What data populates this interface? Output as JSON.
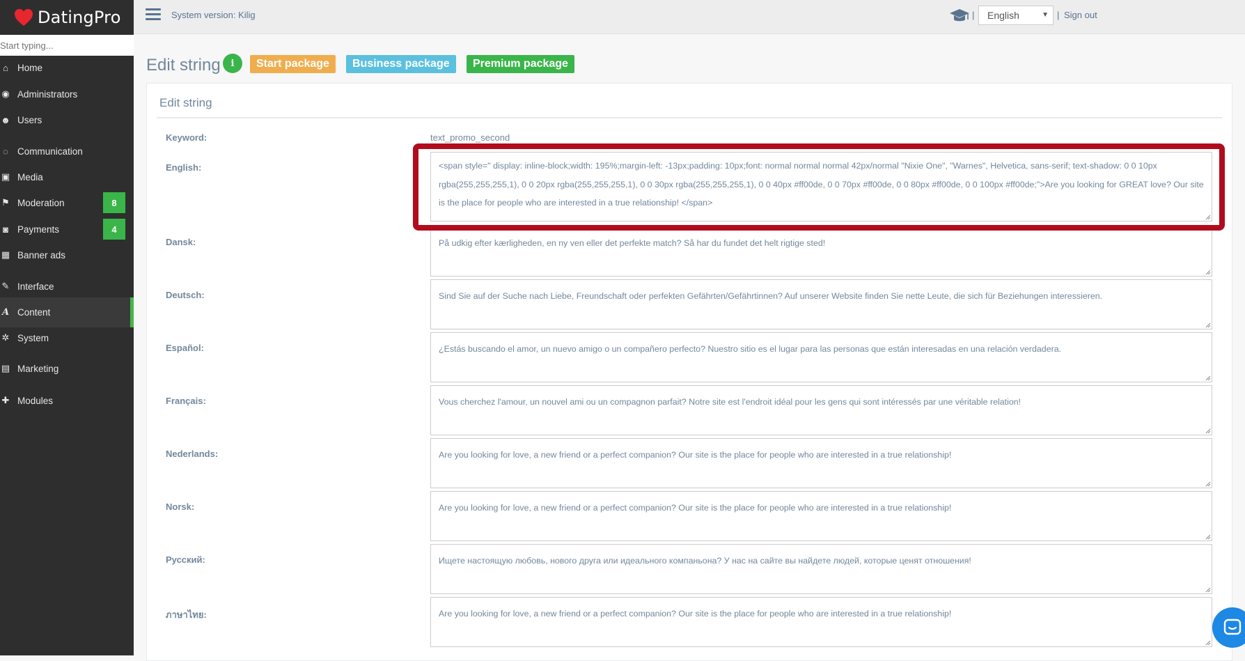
{
  "app": {
    "brand": "DatingPro"
  },
  "sidebar": {
    "search_placeholder": "Start typing...",
    "items": [
      {
        "label": "Home",
        "icon": "home-icon"
      },
      {
        "label": "Administrators",
        "icon": "eye-icon"
      },
      {
        "label": "Users",
        "icon": "users-icon"
      },
      {
        "label": "Communication",
        "icon": "comments-icon"
      },
      {
        "label": "Media",
        "icon": "image-icon"
      },
      {
        "label": "Moderation",
        "icon": "flag-icon",
        "badge": "8"
      },
      {
        "label": "Payments",
        "icon": "money-icon",
        "badge": "4"
      },
      {
        "label": "Banner ads",
        "icon": "grid-icon"
      },
      {
        "label": "Interface",
        "icon": "brush-icon"
      },
      {
        "label": "Content",
        "icon": "font-icon",
        "active": true
      },
      {
        "label": "System",
        "icon": "gear-icon"
      },
      {
        "label": "Marketing",
        "icon": "keyboard-icon"
      },
      {
        "label": "Modules",
        "icon": "puzzle-icon"
      }
    ]
  },
  "topbar": {
    "system_version": "System version: Kilig",
    "separator": "|",
    "language": "English",
    "sign_out": "Sign out"
  },
  "header": {
    "title": "Edit string",
    "info": "i",
    "packages": [
      "Start package",
      "Business package",
      "Premium package"
    ]
  },
  "panel": {
    "title": "Edit string",
    "keyword_label": "Keyword:",
    "keyword_value": "text_promo_second",
    "fields": [
      {
        "label": "English:",
        "value": "<span style=\" display: inline-block;width: 195%;margin-left: -13px;padding: 10px;font: normal normal normal 42px/normal \"Nixie One\", \"Warnes\", Helvetica, sans-serif;    text-shadow: 0 0 10px rgba(255,255,255,1), 0 0 20px rgba(255,255,255,1), 0 0 30px rgba(255,255,255,1), 0 0 40px #ff00de, 0 0 70px #ff00de, 0 0 80px #ff00de, 0 0 100px #ff00de;\">Are you looking for GREAT love? Our site is the place for people who are interested in a true relationship! </span>"
      },
      {
        "label": "Dansk:",
        "value": "På udkig efter kærligheden, en ny ven eller det perfekte match? Så har du fundet det helt rigtige sted!"
      },
      {
        "label": "Deutsch:",
        "value": "Sind Sie auf der Suche nach Liebe, Freundschaft oder perfekten Gefährten/Gefährtinnen? Auf unserer Website finden Sie nette Leute, die sich für Beziehungen interessieren."
      },
      {
        "label": "Español:",
        "value": "¿Estás buscando el amor, un nuevo amigo o un compañero perfecto? Nuestro sitio es el lugar para las personas que están interesadas en una relación verdadera."
      },
      {
        "label": "Français:",
        "value": "Vous cherchez l'amour, un nouvel ami ou un compagnon parfait? Notre site est l'endroit idéal pour les gens qui sont intéressés par une véritable relation!"
      },
      {
        "label": "Nederlands:",
        "value": "Are you looking for love, a new friend or a perfect companion? Our site is the place for people who are interested in a true relationship!"
      },
      {
        "label": "Norsk:",
        "value": "Are you looking for love, a new friend or a perfect companion? Our site is the place for people who are interested in a true relationship!"
      },
      {
        "label": "Русский:",
        "value": "Ищете настоящую любовь, нового друга или идеального компаньона? У нас на сайте вы найдете людей, которые ценят отношения!"
      },
      {
        "label": "ภาษาไทย:",
        "value": "Are you looking for love, a new friend or a perfect companion? Our site is the place for people who are interested in a true relationship!"
      }
    ]
  },
  "colors": {
    "sidebar_bg": "#2e2e2e",
    "accent_green": "#3ab54a",
    "start_package": "#f0ad4e",
    "business_package": "#5bc0de",
    "highlight_border": "#b10c1e",
    "chat_button": "#1e88e5"
  }
}
